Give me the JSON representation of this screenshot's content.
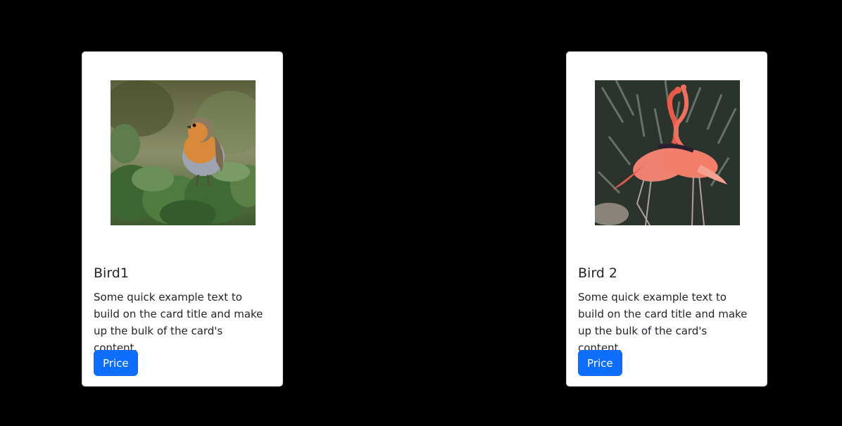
{
  "cards": [
    {
      "title": "Bird1",
      "text": "Some quick example text to build on the card title and make up the bulk of the card's content.",
      "button_label": "Price",
      "image_subject": "robin"
    },
    {
      "title": "Bird 2",
      "text": "Some quick example text to build on the card title and make up the bulk of the card's content.",
      "button_label": "Price",
      "image_subject": "flamingos"
    }
  ],
  "colors": {
    "background": "#000000",
    "card": "#ffffff",
    "button": "#0d6efd",
    "text": "#212529"
  }
}
